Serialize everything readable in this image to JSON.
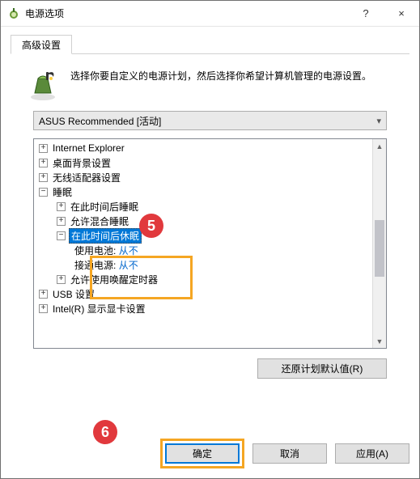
{
  "window": {
    "title": "电源选项",
    "help_tooltip": "?",
    "close_tooltip": "×"
  },
  "tabs": {
    "advanced": "高级设置"
  },
  "description": "选择你要自定义的电源计划，然后选择你希望计算机管理的电源设置。",
  "plan_selector": {
    "value": "ASUS Recommended [活动]"
  },
  "tree": {
    "ie": "Internet Explorer",
    "desktop_bg": "桌面背景设置",
    "wireless": "无线适配器设置",
    "sleep": {
      "label": "睡眠",
      "sleep_after": "在此时间后睡眠",
      "hybrid": "允许混合睡眠",
      "hibernate_after": {
        "label": "在此时间后休眠",
        "battery_key": "使用电池:",
        "battery_val": "从不",
        "plugged_key": "接通电源:",
        "plugged_val": "从不"
      },
      "wake_timers": "允许使用唤醒定时器"
    },
    "usb": "USB 设置",
    "intel": "Intel(R) 显示显卡设置"
  },
  "buttons": {
    "restore": "还原计划默认值(R)",
    "ok": "确定",
    "cancel": "取消",
    "apply": "应用(A)"
  },
  "markers": {
    "five": "5",
    "six": "6"
  }
}
